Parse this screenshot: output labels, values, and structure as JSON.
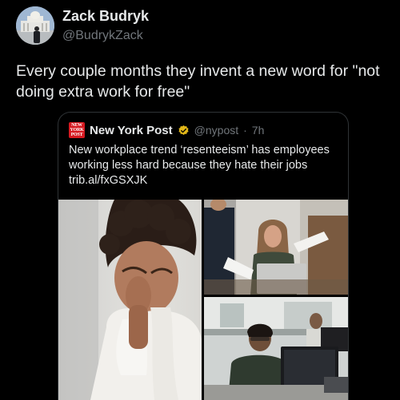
{
  "author": {
    "display_name": "Zack Budryk",
    "handle": "@BudrykZack"
  },
  "tweet": {
    "text": "Every couple months they invent a new word for \"not doing extra work for free\""
  },
  "quoted": {
    "logo_text": [
      "NEW",
      "YORK",
      "POST"
    ],
    "display_name": "New York Post",
    "handle": "@nypost",
    "separator": "·",
    "time": "7h",
    "text": "New workplace trend ‘resenteeism’ has employees working less hard because they hate their jobs trib.al/fxGSXJK"
  },
  "colors": {
    "background": "#000000",
    "text": "#e7e9ea",
    "secondary_text": "#71767b",
    "border": "#2f3336",
    "brand_red": "#d71920",
    "verified_gold": "#e2b719"
  },
  "icons": {
    "verified": "verified-gold-badge-icon"
  }
}
